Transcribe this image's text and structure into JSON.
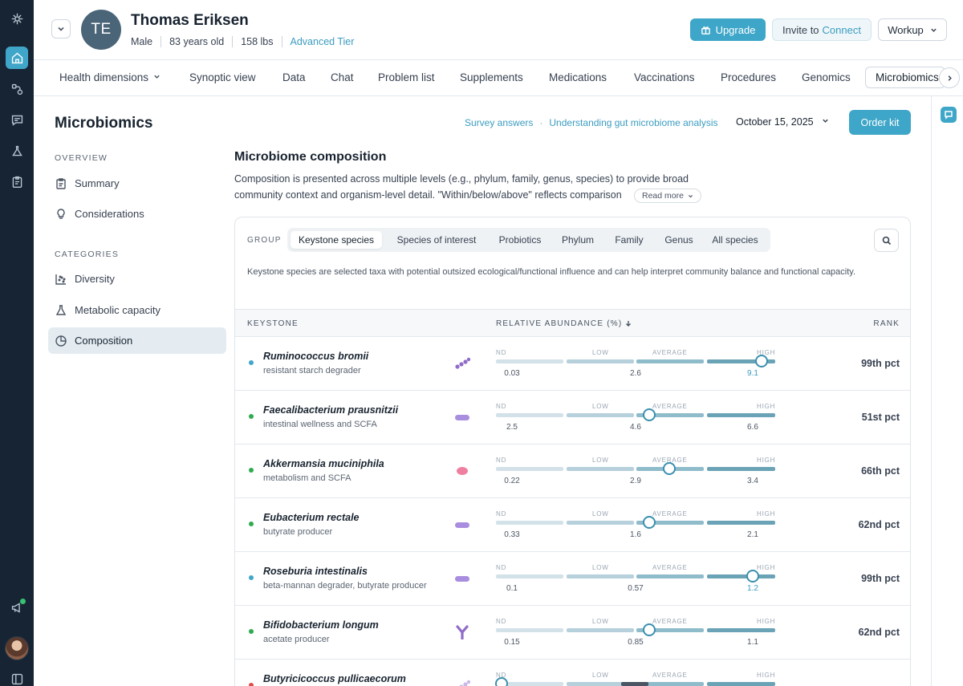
{
  "rail": {
    "items": [
      {
        "name": "logo-icon"
      },
      {
        "name": "home-icon"
      },
      {
        "name": "workflow-icon"
      },
      {
        "name": "chat-icon"
      },
      {
        "name": "lab-flask-icon"
      },
      {
        "name": "clipboard-icon"
      }
    ]
  },
  "patient": {
    "initials": "TE",
    "name": "Thomas Eriksen",
    "sex": "Male",
    "age": "83 years old",
    "weight": "158 lbs",
    "tier": "Advanced Tier"
  },
  "header": {
    "upgrade_label": "Upgrade",
    "invite_label": "Invite to",
    "invite_link": "Connect",
    "workup_label": "Workup"
  },
  "tabs": [
    {
      "label": "Health dimensions",
      "dropdown": true
    },
    {
      "label": "Synoptic view"
    },
    {
      "label": "Data"
    },
    {
      "label": "Chat"
    },
    {
      "label": "Problem list"
    },
    {
      "label": "Supplements"
    },
    {
      "label": "Medications"
    },
    {
      "label": "Vaccinations"
    },
    {
      "label": "Procedures"
    },
    {
      "label": "Genomics"
    },
    {
      "label": "Microbiomics",
      "active": true
    }
  ],
  "sidepanel": {
    "title": "Microbiomics",
    "overview_label": "OVERVIEW",
    "categories_label": "CATEGORIES",
    "items": [
      {
        "label": "Summary",
        "icon": "clipboard-icon"
      },
      {
        "label": "Considerations",
        "icon": "lightbulb-icon"
      },
      {
        "label": "Diversity",
        "icon": "scatter-icon"
      },
      {
        "label": "Metabolic capacity",
        "icon": "flask-icon"
      },
      {
        "label": "Composition",
        "icon": "pie-icon",
        "active": true
      }
    ]
  },
  "main": {
    "link_survey": "Survey answers",
    "link_understanding": "Understanding gut microbiome analysis",
    "date": "October 15, 2025",
    "order_kit": "Order kit",
    "title": "Microbiome composition",
    "desc_line1": "Composition is presented across multiple levels (e.g., phylum, family, genus, species) to provide broad",
    "desc_line2": "community context and organism-level detail. \"Within/below/above\" reflects comparison",
    "read_more": "Read more"
  },
  "group": {
    "label": "GROUP",
    "options": [
      "Keystone species",
      "Species of interest",
      "Probiotics",
      "Phylum",
      "Family",
      "Genus",
      "All species"
    ],
    "selected": "Keystone species",
    "description": "Keystone species are selected taxa with potential outsized ecological/functional influence and can help interpret community balance and functional capacity."
  },
  "table": {
    "col_keystone": "KEYSTONE",
    "col_abundance": "RELATIVE ABUNDANCE (%)",
    "col_rank": "RANK",
    "scale_labels": [
      "ND",
      "LOW",
      "AVERAGE",
      "HIGH"
    ],
    "rows": [
      {
        "name": "Ruminococcus bromii",
        "desc": "resistant starch degrader",
        "dot": "#3fa6c9",
        "icon": "chain-bacteria-icon",
        "icon_color": "#8f6cc7",
        "low": "0.03",
        "avg": "2.6",
        "high": "9.1",
        "value_highlight": true,
        "position": 0.95,
        "rank": "99th pct"
      },
      {
        "name": "Faecalibacterium prausnitzii",
        "desc": "intestinal wellness and SCFA",
        "dot": "#2eaa4f",
        "icon": "rod-bacteria-icon",
        "icon_color": "#a98ee0",
        "low": "2.5",
        "avg": "4.6",
        "high": "6.6",
        "value_highlight": false,
        "position": 0.55,
        "rank": "51st pct"
      },
      {
        "name": "Akkermansia muciniphila",
        "desc": "metabolism and SCFA",
        "dot": "#2eaa4f",
        "icon": "oval-bacteria-icon",
        "icon_color": "#ef7fa0",
        "low": "0.22",
        "avg": "2.9",
        "high": "3.4",
        "value_highlight": false,
        "position": 0.62,
        "rank": "66th pct"
      },
      {
        "name": "Eubacterium rectale",
        "desc": "butyrate producer",
        "dot": "#2eaa4f",
        "icon": "rod-bacteria-icon",
        "icon_color": "#a98ee0",
        "low": "0.33",
        "avg": "1.6",
        "high": "2.1",
        "value_highlight": false,
        "position": 0.55,
        "rank": "62nd pct"
      },
      {
        "name": "Roseburia intestinalis",
        "desc": "beta-mannan degrader, butyrate producer",
        "dot": "#3fa6c9",
        "icon": "rod-bacteria-icon",
        "icon_color": "#a98ee0",
        "low": "0.1",
        "avg": "0.57",
        "high": "1.2",
        "value_highlight": true,
        "position": 0.92,
        "rank": "99th pct"
      },
      {
        "name": "Bifidobacterium longum",
        "desc": "acetate producer",
        "dot": "#2eaa4f",
        "icon": "y-bacteria-icon",
        "icon_color": "#8f6cc7",
        "low": "0.15",
        "avg": "0.85",
        "high": "1.1",
        "value_highlight": false,
        "position": 0.55,
        "rank": "62nd pct"
      },
      {
        "name": "Butyricicoccus pullicaecorum",
        "desc": "",
        "dot": "#e04b4b",
        "icon": "chain-bacteria-icon",
        "icon_color": "#c9b8e8",
        "low": "",
        "avg": "",
        "high": "",
        "value_highlight": false,
        "position": 0.02,
        "rank": ""
      }
    ]
  },
  "colors": {
    "accent": "#3ea6c8",
    "rail_bg": "#172433",
    "bar_nd": "#d3e1e9",
    "bar_low": "#b6d0dc",
    "bar_avg": "#8fbccb",
    "bar_high": "#6ba3b6"
  }
}
